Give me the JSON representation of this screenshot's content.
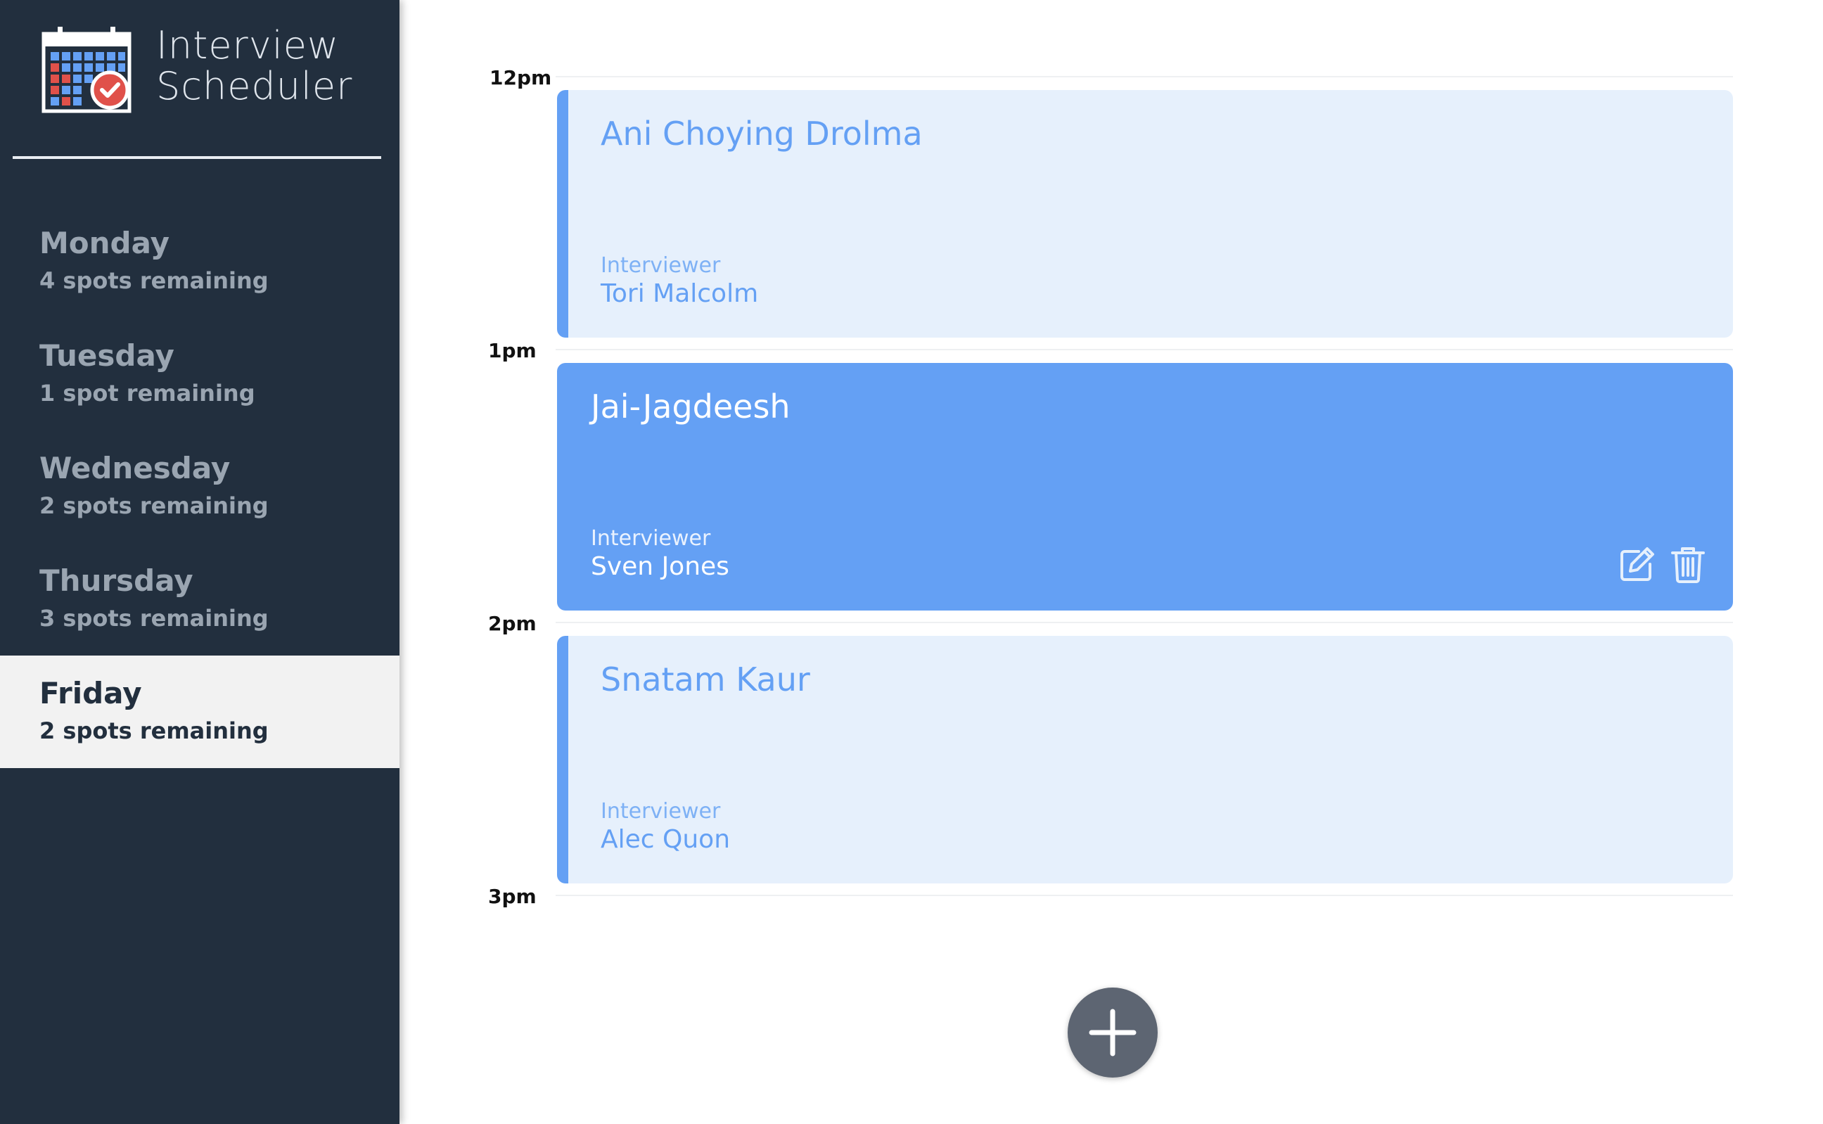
{
  "app": {
    "title_line1": "Interview",
    "title_line2": "Scheduler"
  },
  "days": [
    {
      "name": "Monday",
      "spots": "4 spots remaining",
      "selected": false
    },
    {
      "name": "Tuesday",
      "spots": "1 spot remaining",
      "selected": false
    },
    {
      "name": "Wednesday",
      "spots": "2 spots remaining",
      "selected": false
    },
    {
      "name": "Thursday",
      "spots": "3 spots remaining",
      "selected": false
    },
    {
      "name": "Friday",
      "spots": "2 spots remaining",
      "selected": true
    }
  ],
  "times": [
    "12pm",
    "1pm",
    "2pm",
    "3pm"
  ],
  "appointments": [
    {
      "student": "Ani Choying Drolma",
      "interviewer_label": "Interviewer",
      "interviewer": "Tori Malcolm",
      "highlighted": false
    },
    {
      "student": "Jai-Jagdeesh",
      "interviewer_label": "Interviewer",
      "interviewer": "Sven Jones",
      "highlighted": true
    },
    {
      "student": "Snatam Kaur",
      "interviewer_label": "Interviewer",
      "interviewer": "Alec Quon",
      "highlighted": false
    }
  ],
  "icons": {
    "logo": "calendar-check-icon",
    "edit": "edit-icon",
    "delete": "trash-icon",
    "add": "plus-icon"
  },
  "colors": {
    "sidebar_bg": "#222f3e",
    "accent": "#64a0f4",
    "appointment_light_bg": "#e6f0fc",
    "selected_day_bg": "#f2f2f2",
    "add_button_bg": "#5d6572",
    "logo_red": "#e0514a"
  }
}
